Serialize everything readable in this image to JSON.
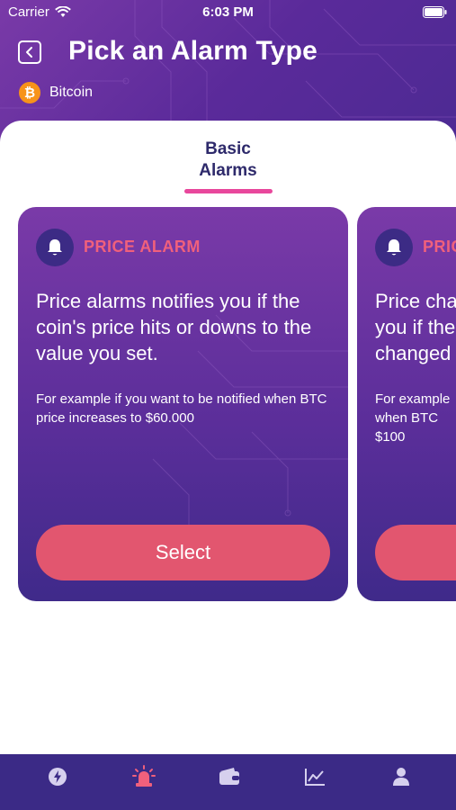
{
  "status_bar": {
    "carrier": "Carrier",
    "time": "6:03 PM"
  },
  "header": {
    "title": "Pick an Alarm Type",
    "coin_name": "Bitcoin",
    "coin_symbol": "₿"
  },
  "tabs": [
    {
      "label_line1": "Basic",
      "label_line2": "Alarms",
      "active": true
    }
  ],
  "cards": [
    {
      "title": "PRICE ALARM",
      "description": "Price alarms notifies you if the coin's price hits or downs to the value you set.",
      "example": "For example if you want to be notified when BTC price increases to $60.000",
      "button": "Select"
    },
    {
      "title": "PRIC",
      "description_lines": [
        "Price cha",
        "you if the",
        "changed"
      ],
      "example_lines": [
        "For example",
        "when BTC",
        "$100"
      ]
    }
  ],
  "tabbar": {
    "items": [
      {
        "icon": "bolt-icon",
        "active": false
      },
      {
        "icon": "alarm-siren-icon",
        "active": true
      },
      {
        "icon": "wallet-icon",
        "active": false
      },
      {
        "icon": "chart-icon",
        "active": false
      },
      {
        "icon": "profile-icon",
        "active": false
      }
    ]
  },
  "colors": {
    "header_gradient": [
      "#7a3aa8",
      "#4b2a92"
    ],
    "accent_pink": "#e8479c",
    "card_title": "#f0607c",
    "select_button": "#e2566f",
    "tabbar_bg": "#3b2a86",
    "tab_active": "#f0607c",
    "tab_inactive": "#d6d0ee"
  }
}
